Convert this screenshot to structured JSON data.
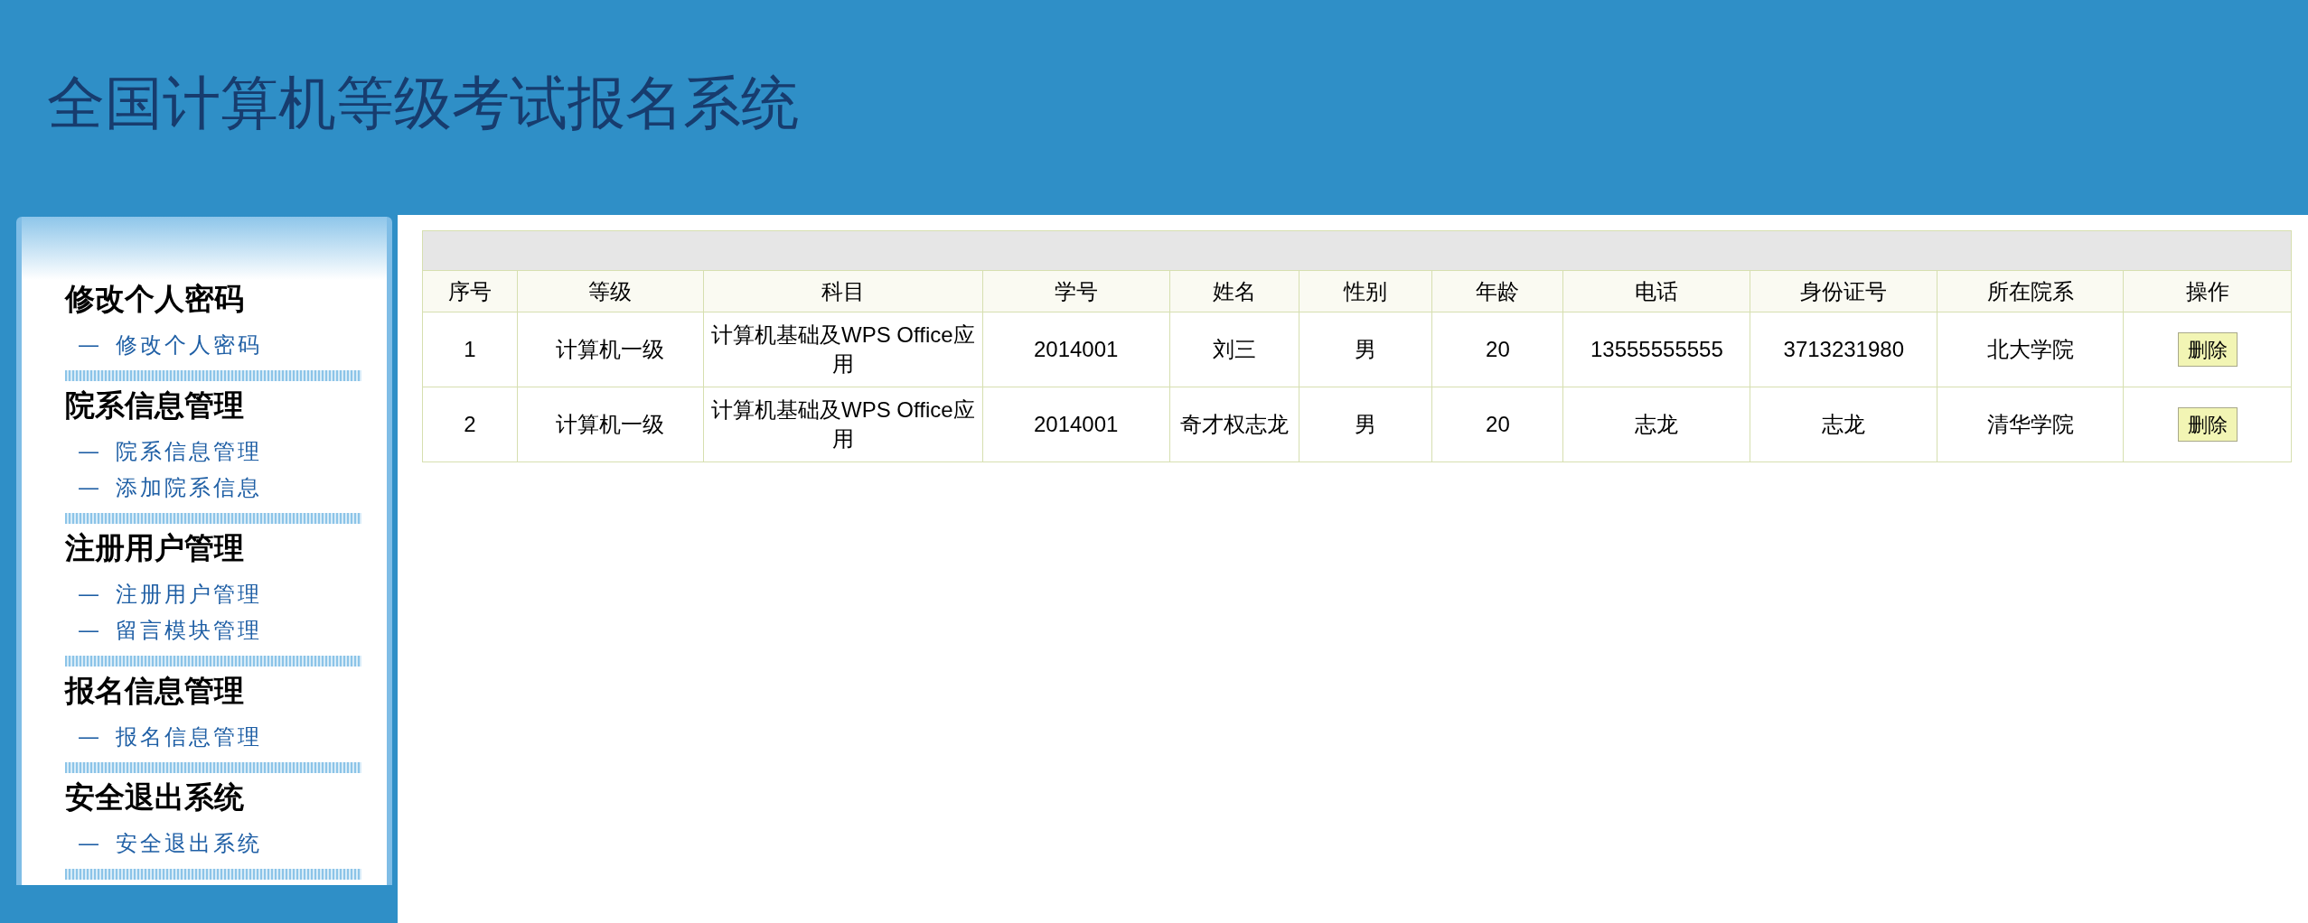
{
  "header": {
    "title": "全国计算机等级考试报名系统"
  },
  "sidebar": {
    "groups": [
      {
        "title": "修改个人密码",
        "items": [
          {
            "bullet": "—",
            "label": "修改个人密码"
          }
        ]
      },
      {
        "title": "院系信息管理",
        "items": [
          {
            "bullet": "—",
            "label": "院系信息管理"
          },
          {
            "bullet": "—",
            "label": "添加院系信息"
          }
        ]
      },
      {
        "title": "注册用户管理",
        "items": [
          {
            "bullet": "—",
            "label": "注册用户管理"
          },
          {
            "bullet": "—",
            "label": "留言模块管理"
          }
        ]
      },
      {
        "title": "报名信息管理",
        "items": [
          {
            "bullet": "—",
            "label": "报名信息管理"
          }
        ]
      },
      {
        "title": "安全退出系统",
        "items": [
          {
            "bullet": "—",
            "label": "安全退出系统"
          }
        ]
      }
    ]
  },
  "table": {
    "columns": [
      "序号",
      "等级",
      "科目",
      "学号",
      "姓名",
      "性别",
      "年龄",
      "电话",
      "身份证号",
      "所在院系",
      "操作"
    ],
    "rows": [
      {
        "cells": [
          "1",
          "计算机一级",
          "计算机基础及WPS Office应用",
          "2014001",
          "刘三",
          "男",
          "20",
          "13555555555",
          "3713231980",
          "北大学院"
        ],
        "action": "删除"
      },
      {
        "cells": [
          "2",
          "计算机一级",
          "计算机基础及WPS Office应用",
          "2014001",
          "奇才权志龙",
          "男",
          "20",
          "志龙",
          "志龙",
          "清华学院"
        ],
        "action": "删除"
      }
    ]
  }
}
